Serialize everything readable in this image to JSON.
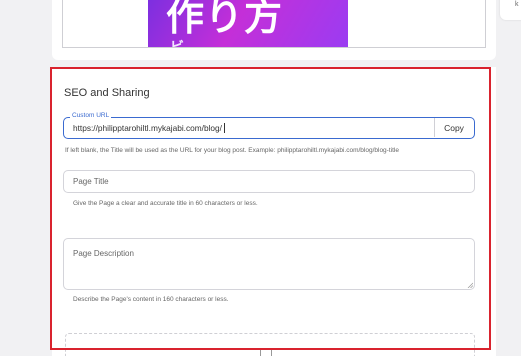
{
  "featured_image": {
    "text": "作り方",
    "sub_text": "ビ"
  },
  "side_panel": {
    "char": "k"
  },
  "seo_section": {
    "title": "SEO and Sharing",
    "custom_url": {
      "label": "Custom URL",
      "value": "https://philipptarohiltl.mykajabi.com/blog/",
      "copy_label": "Copy",
      "hint": "If left blank, the Title will be used as the URL for your blog post. Example: philipptarohiltl.mykajabi.com/blog/blog-title"
    },
    "page_title": {
      "placeholder": "Page Title",
      "hint": "Give the Page a clear and accurate title in 60 characters or less."
    },
    "page_description": {
      "placeholder": "Page Description",
      "hint": "Describe the Page's content in 160 characters or less."
    }
  },
  "colors": {
    "accent": "#3a6ad0",
    "highlight": "#d9232e",
    "promo_gradient_start": "#7b2fe0",
    "promo_gradient_end": "#c42fd8"
  }
}
